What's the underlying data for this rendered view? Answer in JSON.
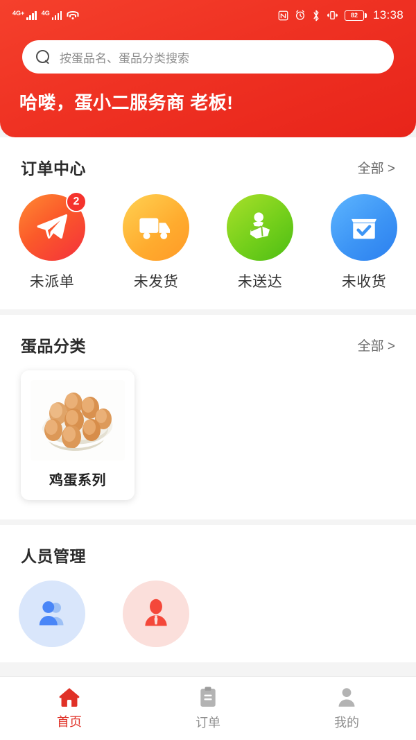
{
  "status_bar": {
    "sim1_network": "4G+",
    "sim2_network": "4G",
    "wifi_icon": "wifi-icon",
    "nfc_icon": "nfc-icon",
    "alarm_icon": "alarm-clock-icon",
    "bluetooth_icon": "bluetooth-icon",
    "vibrate_icon": "vibrate-icon",
    "battery_level": "82",
    "time": "13:38"
  },
  "header": {
    "search": {
      "placeholder": "按蛋品名、蛋品分类搜索",
      "value": "",
      "icon": "search-icon"
    },
    "greeting": "哈喽，蛋小二服务商 老板!",
    "background_color": "#ef3223"
  },
  "order_center": {
    "title": "订单中心",
    "more_label": "全部 >",
    "items": [
      {
        "label": "未派单",
        "icon": "paper-plane-icon",
        "badge": "2"
      },
      {
        "label": "未发货",
        "icon": "truck-icon",
        "badge": ""
      },
      {
        "label": "未送达",
        "icon": "delivery-person-icon",
        "badge": ""
      },
      {
        "label": "未收货",
        "icon": "box-check-icon",
        "badge": ""
      }
    ]
  },
  "egg_categories": {
    "title": "蛋品分类",
    "more_label": "全部 >",
    "items": [
      {
        "name": "鸡蛋系列",
        "image": "brown-eggs-photo"
      }
    ]
  },
  "personnel": {
    "title": "人员管理",
    "items": [
      {
        "label": "",
        "icon": "two-people-icon",
        "color": "#4a86f7"
      },
      {
        "label": "",
        "icon": "person-tie-icon",
        "color": "#f4483a"
      }
    ]
  },
  "tabbar": {
    "items": [
      {
        "label": "首页",
        "icon": "home-icon",
        "active": true
      },
      {
        "label": "订单",
        "icon": "clipboard-icon",
        "active": false
      },
      {
        "label": "我的",
        "icon": "person-icon",
        "active": false
      }
    ]
  },
  "colors": {
    "brand_red": "#ef3223",
    "active_tab": "#e03127",
    "badge_red": "#f5332d"
  }
}
